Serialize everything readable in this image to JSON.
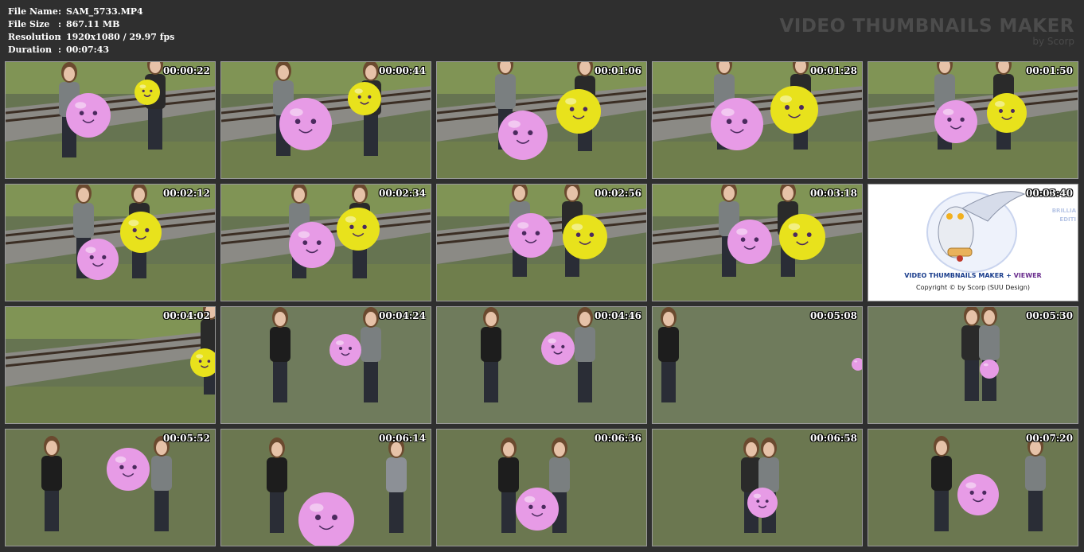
{
  "file_info": {
    "name_label": "File Name",
    "name_value": "SAM_5733.MP4",
    "size_label": "File Size",
    "size_value": "867.11 MB",
    "resolution_label": "Resolution",
    "resolution_value": "1920x1080 / 29.97 fps",
    "duration_label": "Duration",
    "duration_value": "00:07:43",
    "separator": ":"
  },
  "brand": {
    "title": "VIDEO THUMBNAILS MAKER",
    "subtitle": "by Scorp"
  },
  "timestamps": [
    "00:00:22",
    "00:00:44",
    "00:01:06",
    "00:01:28",
    "00:01:50",
    "00:02:12",
    "00:02:34",
    "00:02:56",
    "00:03:18",
    "00:03:40",
    "00:04:02",
    "00:04:24",
    "00:04:46",
    "00:05:08",
    "00:05:30",
    "00:05:52",
    "00:06:14",
    "00:06:36",
    "00:06:58",
    "00:07:20"
  ],
  "ad": {
    "title_part1": "VIDEO THUMBNAILS MAKER",
    "title_plus": " + ",
    "title_part2": "VIEWER",
    "copyright": "Copyright © by Scorp (SUU Design)",
    "side_line1": "BRILLIA",
    "side_line2": "EDITI"
  },
  "colors": {
    "background": "#2f2f2f",
    "brand_text": "#4c4c4c",
    "pink_balloon": "#e79be6",
    "yellow_balloon": "#e8e21c",
    "grass": "#6f7a57"
  }
}
